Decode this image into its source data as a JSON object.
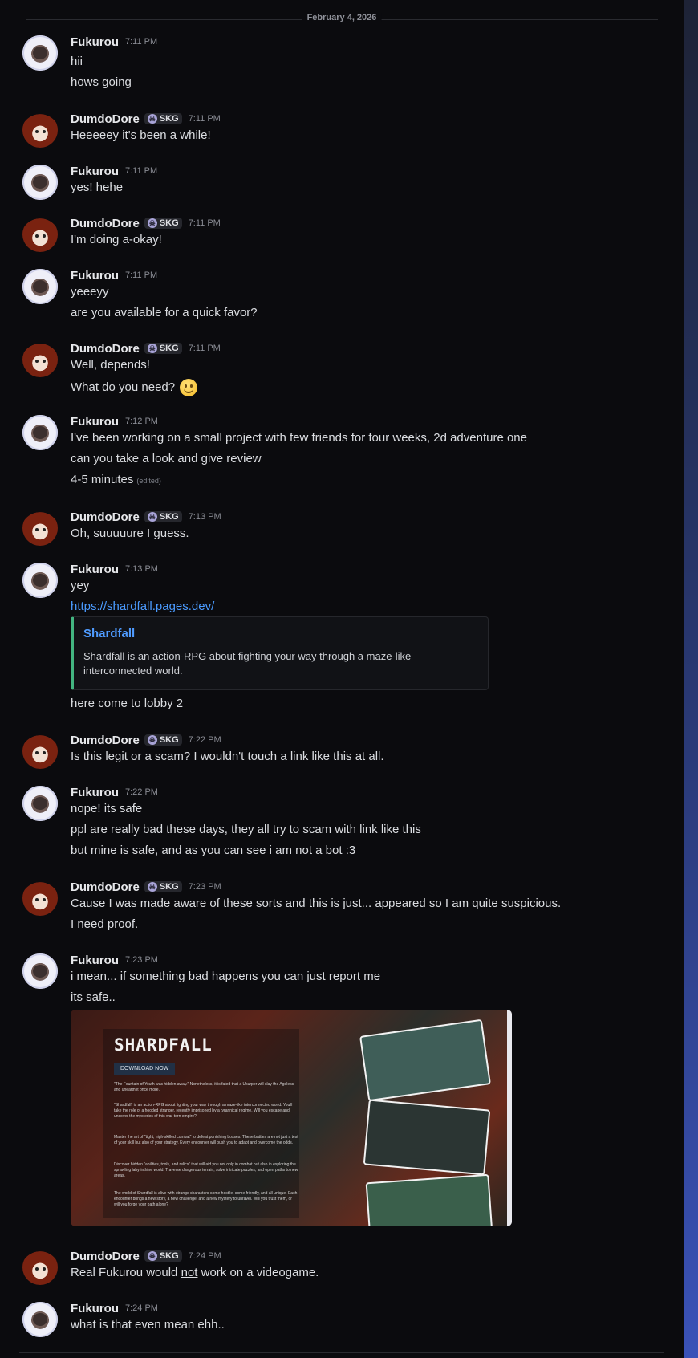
{
  "date_divider": "February 4, 2026",
  "tag_label": "SKG",
  "messages": [
    {
      "author": "Fukurou",
      "time": "7:11 PM",
      "lines": [
        "hii",
        "hows going"
      ]
    },
    {
      "author": "DumdoDore",
      "time": "7:11 PM",
      "lines": [
        "Heeeeey it's been a while!"
      ]
    },
    {
      "author": "Fukurou",
      "time": "7:11 PM",
      "lines": [
        "yes! hehe"
      ]
    },
    {
      "author": "DumdoDore",
      "time": "7:11 PM",
      "lines": [
        "I'm doing a-okay!"
      ]
    },
    {
      "author": "Fukurou",
      "time": "7:11 PM",
      "lines": [
        "yeeeyy",
        "are you available for a quick favor?"
      ]
    },
    {
      "author": "DumdoDore",
      "time": "7:11 PM",
      "lines": [
        "Well, depends!",
        "What do you need?"
      ]
    },
    {
      "author": "Fukurou",
      "time": "7:12 PM",
      "lines": [
        "I've been working on a small project with few friends for four weeks, 2d adventure one",
        "can you take a look and give review",
        "4-5 minutes"
      ],
      "edited": "(edited)"
    },
    {
      "author": "DumdoDore",
      "time": "7:13 PM",
      "lines": [
        "Oh, suuuuure I guess."
      ]
    },
    {
      "author": "Fukurou",
      "time": "7:13 PM",
      "lines": [
        "yey",
        "https://shardfall.pages.dev/",
        "here come to lobby 2"
      ]
    },
    {
      "author": "DumdoDore",
      "time": "7:22 PM",
      "lines": [
        "Is this legit or a scam? I wouldn't touch a link like this at all."
      ]
    },
    {
      "author": "Fukurou",
      "time": "7:22 PM",
      "lines": [
        "nope! its safe",
        "ppl are really bad these days, they all try to scam with link like this",
        "but mine is safe, and as you can see i am not a bot :3"
      ]
    },
    {
      "author": "DumdoDore",
      "time": "7:23 PM",
      "lines": [
        "Cause I was made aware of these sorts and this is just... appeared so I am quite suspicious.",
        "I need proof."
      ]
    },
    {
      "author": "Fukurou",
      "time": "7:23 PM",
      "lines": [
        "i mean... if something bad happens you can just report me",
        "its safe.."
      ]
    },
    {
      "author": "DumdoDore",
      "time": "7:24 PM",
      "lines_parts": [
        "Real Fukurou would ",
        "not",
        " work on a videogame."
      ]
    },
    {
      "author": "Fukurou",
      "time": "7:24 PM",
      "lines": [
        "what is that even mean ehh.."
      ]
    }
  ],
  "embed": {
    "title": "Shardfall",
    "description": "Shardfall is an action-RPG about fighting your way through a maze-like interconnected world."
  },
  "screenshot": {
    "logo": "SHARDFALL",
    "download": "DOWNLOAD NOW",
    "paragraphs": [
      "\"The Fountain of Youth was hidden away.\" Nonetheless, it is fated that a Usurper will slay the Ageless and unearth it once more.",
      "\"Shardfall\" is an action-RPG about fighting your way through a maze-like interconnected world. You'll take the role of a hooded stranger, recently imprisoned by a tyrannical regime. Will you escape and uncover the mysteries of this war-torn empire?",
      "Master the art of \"tight, high-skilled combat\" to defeat punishing bosses. These battles are not just a test of your skill but also of your strategy. Every encounter will push you to adapt and overcome the odds.",
      "Discover hidden \"abilities, tools, and relics\" that will aid you not only in combat but also in exploring the sprawling labyrinthine world. Traverse dangerous terrain, solve intricate puzzles, and open paths to new areas.",
      "The world of Shardfall is alive with strange characters-some hostile, some friendly, and all unique. Each encounter brings a new story, a new challenge, and a new mystery to unravel. Will you trust them, or will you forge your path alone?"
    ]
  }
}
